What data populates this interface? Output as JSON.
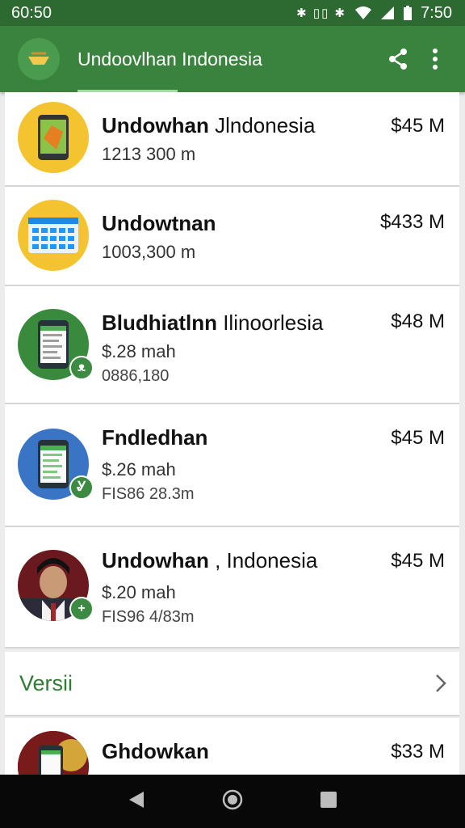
{
  "status_bar": {
    "time_left": "60:50",
    "time_right": "7:50",
    "icons": "✱ ▯▯ ✱"
  },
  "app_bar": {
    "title": "Undoovlhan Indonesia"
  },
  "items": [
    {
      "title_bold": "Undowhan",
      "title_rest": " Jlndonesia",
      "price": "$45 M",
      "line1": "1213 300 m",
      "line2": "",
      "thumb": "phone-map-icon",
      "color": "#f4c430"
    },
    {
      "title_bold": "Undowtnan",
      "title_rest": "",
      "price": "$433 M",
      "line1": "1003,300 m",
      "line2": "",
      "thumb": "calendar-icon",
      "color": "#f4c430"
    },
    {
      "title_bold": "Bludhiatlnn",
      "title_rest": " Ilinoorlesia",
      "price": "$48 M",
      "line1": "$.28 mah",
      "line2": "0886,180",
      "thumb": "phone-list-icon",
      "color": "#3a8a3e",
      "badge": "ᴥ"
    },
    {
      "title_bold": "Fndledhan",
      "title_rest": "",
      "price": "$45 M",
      "line1": "$.26 mah",
      "line2": "FIS86 28.3m",
      "thumb": "phone-list-icon",
      "color": "#3a74c4",
      "badge": "Ꮍ"
    },
    {
      "title_bold": "Undowhan",
      "title_rest": " , Indonesia",
      "price": "$45 M",
      "line1": "$.20 mah",
      "line2": "FIS96 4/83m",
      "thumb": "avatar-icon",
      "color": "#f0f0f0",
      "badge": "+"
    }
  ],
  "section": {
    "label": "Versii"
  },
  "last_item": {
    "title": "Ghdowkan",
    "price": "$33 M",
    "line1": ""
  },
  "colors": {
    "primary": "#3a833e",
    "status_bar": "#2d6a31",
    "section_text": "#2e7d32"
  }
}
